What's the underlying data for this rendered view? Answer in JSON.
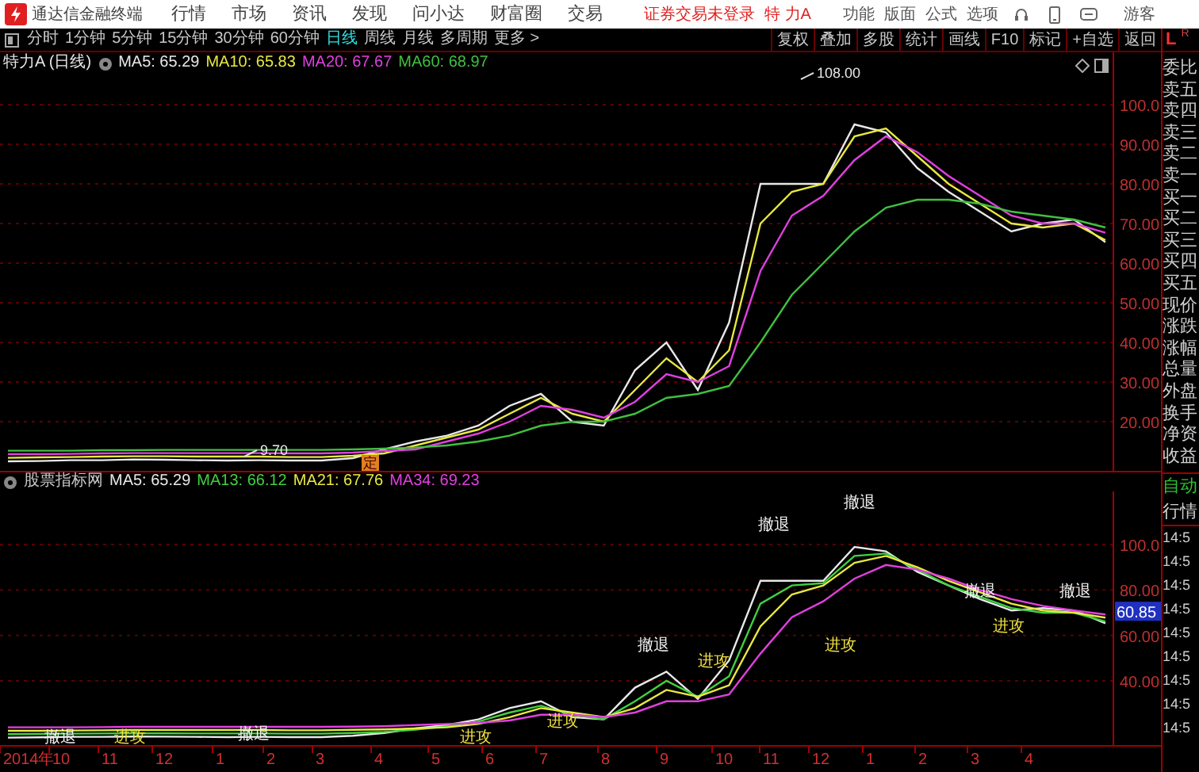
{
  "app": {
    "title": "通达信金融终端",
    "menus": [
      "行情",
      "市场",
      "资讯",
      "发现",
      "问小达",
      "财富圈",
      "交易"
    ],
    "login_status": "证券交易未登录",
    "stock_name": "特 力A",
    "tools": [
      "功能",
      "版面",
      "公式",
      "选项"
    ],
    "user": "游客"
  },
  "toolbar": {
    "periods": [
      {
        "label": "分时",
        "selected": false
      },
      {
        "label": "1分钟",
        "selected": false
      },
      {
        "label": "5分钟",
        "selected": false
      },
      {
        "label": "15分钟",
        "selected": false
      },
      {
        "label": "30分钟",
        "selected": false
      },
      {
        "label": "60分钟",
        "selected": false
      },
      {
        "label": "日线",
        "selected": true
      },
      {
        "label": "周线",
        "selected": false
      },
      {
        "label": "月线",
        "selected": false
      },
      {
        "label": "多周期",
        "selected": false
      },
      {
        "label": "更多 >",
        "selected": false
      }
    ],
    "actions": [
      "复权",
      "叠加",
      "多股",
      "统计",
      "画线",
      "F10",
      "标记",
      "+自选",
      "返回"
    ],
    "side_labels": [
      {
        "label": "L",
        "selected": true
      },
      {
        "label": "R",
        "selected": false
      }
    ]
  },
  "price_panel": {
    "title": "特力A (日线)",
    "marker": "定",
    "price_labels": [
      "108.00",
      "9.70"
    ],
    "chart_data": {
      "type": "line",
      "grid": true,
      "ylim": [
        7.6,
        113.2
      ],
      "yticks": [
        {
          "value": 20,
          "label": "20.00"
        },
        {
          "value": 30,
          "label": "30.00"
        },
        {
          "value": 40,
          "label": "40.00"
        },
        {
          "value": 50,
          "label": "50.00"
        },
        {
          "value": 60,
          "label": "60.00"
        },
        {
          "value": 70,
          "label": "70.00"
        },
        {
          "value": 80,
          "label": "80.00"
        },
        {
          "value": 90,
          "label": "90.00"
        },
        {
          "value": 100,
          "label": "100.0"
        }
      ],
      "series": [
        {
          "name": "MA5: 65.29",
          "color": "#e8e8e8",
          "values": [
            10,
            10.1,
            10.3,
            10.3,
            10.5,
            10.4,
            10.3,
            10.2,
            10.3,
            10.2,
            10.2,
            10.8,
            13,
            15,
            16.5,
            19,
            24,
            27,
            20,
            19,
            33,
            40,
            28,
            45,
            80,
            80,
            80,
            95,
            93,
            84,
            78,
            73,
            68,
            70,
            71,
            65.3
          ]
        },
        {
          "name": "MA10: 65.83",
          "color": "#e8e840",
          "values": [
            10.9,
            11,
            11.1,
            11.2,
            11.3,
            11.3,
            11.2,
            11.2,
            11.2,
            11.1,
            11.1,
            11.4,
            12,
            14,
            16,
            18,
            22,
            26,
            22,
            20,
            28,
            36,
            30,
            38,
            70,
            78,
            80,
            92,
            94,
            87,
            80,
            75,
            70,
            69,
            70,
            65.8
          ]
        },
        {
          "name": "MA20: 67.67",
          "color": "#e040e0",
          "values": [
            11.8,
            11.8,
            11.9,
            12,
            12.1,
            12.1,
            12.1,
            12.1,
            12.1,
            12,
            12,
            12.2,
            12.6,
            13,
            15,
            17,
            20,
            24,
            23,
            21,
            25,
            32,
            30,
            34,
            58,
            72,
            77,
            86,
            92,
            88,
            82,
            77,
            72,
            70,
            70,
            67.7
          ]
        },
        {
          "name": "MA60: 68.97",
          "color": "#40c040",
          "values": [
            12.7,
            12.7,
            12.7,
            12.8,
            12.8,
            12.9,
            12.9,
            12.9,
            12.9,
            12.9,
            12.9,
            13,
            13.2,
            13.5,
            14,
            15,
            16.5,
            19,
            20,
            20,
            22,
            26,
            27,
            29,
            40,
            52,
            60,
            68,
            74,
            76,
            76,
            75,
            73,
            72,
            71,
            69
          ]
        }
      ]
    }
  },
  "indicator_panel": {
    "title": "股票指标网",
    "current_price": "60.85",
    "signals": [
      {
        "label": "撤退",
        "kind": "retreat"
      },
      {
        "label": "进攻",
        "kind": "attack"
      },
      {
        "label": "撤退",
        "kind": "retreat"
      },
      {
        "label": "进攻",
        "kind": "attack"
      },
      {
        "label": "进攻",
        "kind": "attack"
      },
      {
        "label": "撤退",
        "kind": "retreat"
      },
      {
        "label": "进攻",
        "kind": "attack"
      },
      {
        "label": "撤退",
        "kind": "retreat"
      },
      {
        "label": "进攻",
        "kind": "attack"
      },
      {
        "label": "撤退",
        "kind": "retreat"
      },
      {
        "label": "撤退",
        "kind": "retreat"
      },
      {
        "label": "进攻",
        "kind": "attack"
      },
      {
        "label": "撤退",
        "kind": "retreat"
      }
    ],
    "date_axis": [
      "2014年",
      "10",
      "11",
      "12",
      "1",
      "2",
      "3",
      "4",
      "5",
      "6",
      "7",
      "8",
      "9",
      "10",
      "11",
      "12",
      "1",
      "2",
      "3",
      "4"
    ],
    "chart_data": {
      "type": "line",
      "grid": true,
      "ylim": [
        11.7,
        123.4
      ],
      "yticks": [
        {
          "value": 40,
          "label": "40.00"
        },
        {
          "value": 60,
          "label": "60.00"
        },
        {
          "value": 80,
          "label": "80.00"
        },
        {
          "value": 100,
          "label": "100.0"
        }
      ],
      "series": [
        {
          "name": "MA5: 65.29",
          "color": "#e8e8e8",
          "values": [
            15,
            15.1,
            15.3,
            15.3,
            15.5,
            15.4,
            15.3,
            15.2,
            15.3,
            15.2,
            15.2,
            15.8,
            17,
            19,
            20.5,
            23,
            28,
            31,
            24,
            23,
            37,
            44,
            32,
            49,
            84,
            84,
            84,
            99,
            97,
            88,
            82,
            76,
            71,
            72,
            71,
            65.3
          ]
        },
        {
          "name": "MA13: 66.12",
          "color": "#40d040",
          "values": [
            16.5,
            16.6,
            16.7,
            16.8,
            16.9,
            16.9,
            16.8,
            16.8,
            16.8,
            16.7,
            16.7,
            17,
            17.5,
            18.5,
            20,
            22,
            26,
            29,
            25,
            23,
            31,
            40,
            33,
            42,
            74,
            82,
            83,
            95,
            96,
            89,
            82,
            77,
            72,
            70,
            70,
            66.1
          ]
        },
        {
          "name": "MA21: 67.76",
          "color": "#e8e840",
          "values": [
            18,
            18,
            18.1,
            18.2,
            18.3,
            18.3,
            18.3,
            18.3,
            18.3,
            18.2,
            18.2,
            18.4,
            18.6,
            19,
            19.5,
            21,
            24,
            28,
            26,
            24,
            28,
            36,
            33,
            38,
            64,
            78,
            82,
            92,
            95,
            90,
            84,
            79,
            74,
            71,
            70,
            67.8
          ]
        },
        {
          "name": "MA34: 69.23",
          "color": "#e040e0",
          "values": [
            19.5,
            19.5,
            19.5,
            19.6,
            19.7,
            19.7,
            19.7,
            19.7,
            19.7,
            19.7,
            19.7,
            19.8,
            20,
            20.5,
            21,
            21.5,
            22.5,
            25,
            25,
            24,
            26,
            31,
            31,
            34,
            52,
            68,
            75,
            85,
            91,
            89,
            85,
            80,
            76,
            73,
            71,
            69.2
          ]
        }
      ]
    }
  },
  "quote_panel": {
    "fields": [
      "委比",
      "卖五",
      "卖四",
      "卖三",
      "卖二",
      "卖一",
      "买一",
      "买二",
      "买三",
      "买四",
      "买五",
      "现价",
      "涨跌",
      "涨幅",
      "总量",
      "外盘",
      "换手",
      "净资",
      "收益"
    ],
    "mode": "自动",
    "section": "行情",
    "times": [
      "14:5",
      "14:5",
      "14:5",
      "14:5",
      "14:5",
      "14:5",
      "14:5",
      "14:5",
      "14:5"
    ]
  }
}
